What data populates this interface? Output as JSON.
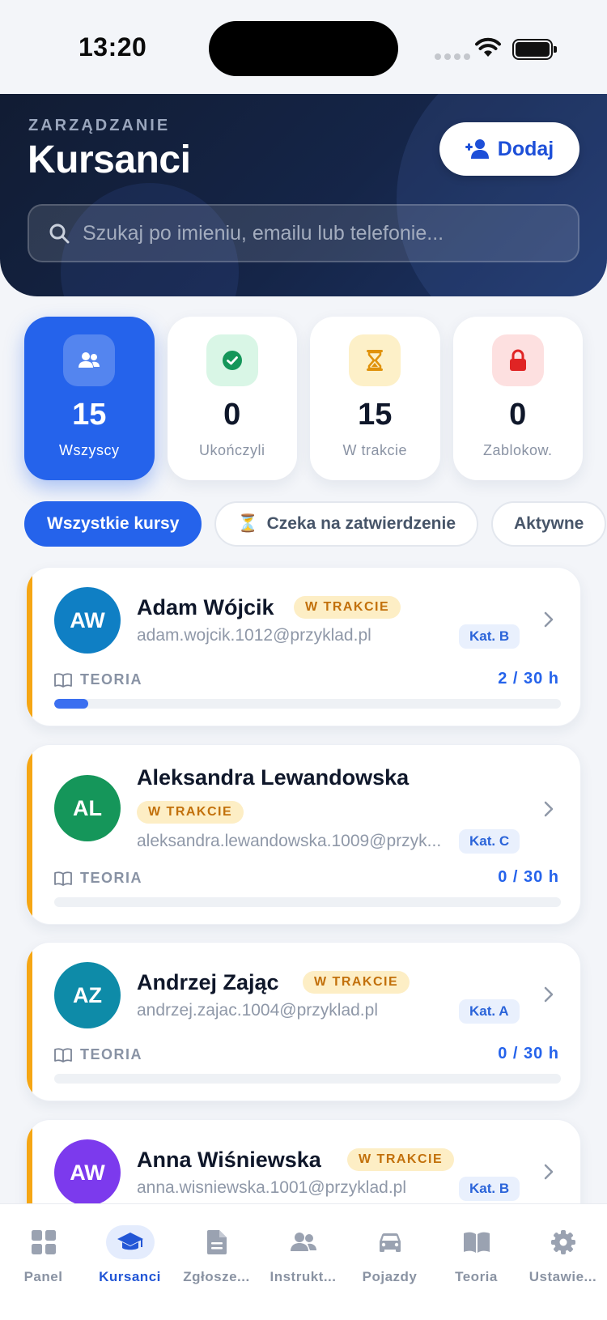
{
  "status_bar": {
    "time": "13:20"
  },
  "header": {
    "eyebrow": "ZARZĄDZANIE",
    "title": "Kursanci",
    "add_button": "Dodaj",
    "search_placeholder": "Szukaj po imieniu, emailu lub telefonie..."
  },
  "stats": [
    {
      "value": "15",
      "label": "Wszyscy",
      "icon": "users-icon",
      "active": true
    },
    {
      "value": "0",
      "label": "Ukończyli",
      "icon": "check-icon"
    },
    {
      "value": "15",
      "label": "W trakcie",
      "icon": "hourglass-icon"
    },
    {
      "value": "0",
      "label": "Zablokow.",
      "icon": "lock-icon"
    }
  ],
  "filters": [
    {
      "label": "Wszystkie kursy",
      "active": true
    },
    {
      "emoji": "⏳",
      "label": "Czeka na zatwierdzenie"
    },
    {
      "label": "Aktywne"
    }
  ],
  "students": [
    {
      "initials": "AW",
      "name": "Adam Wójcik",
      "status": "W TRAKCIE",
      "email": "adam.wojcik.1012@przyklad.pl",
      "category": "Kat. B",
      "theory_label": "TEORIA",
      "hours": "2 / 30 h",
      "progress": 0.067,
      "avatar_color": "#0f7fc4"
    },
    {
      "initials": "AL",
      "name": "Aleksandra Lewandowska",
      "status": "W TRAKCIE",
      "email": "aleksandra.lewandowska.1009@przyk...",
      "category": "Kat. C",
      "theory_label": "TEORIA",
      "hours": "0 / 30 h",
      "progress": 0,
      "avatar_color": "#15965a"
    },
    {
      "initials": "AZ",
      "name": "Andrzej Zając",
      "status": "W TRAKCIE",
      "email": "andrzej.zajac.1004@przyklad.pl",
      "category": "Kat. A",
      "theory_label": "TEORIA",
      "hours": "0 / 30 h",
      "progress": 0,
      "avatar_color": "#0e8ba8"
    },
    {
      "initials": "AW",
      "name": "Anna Wiśniewska",
      "status": "W TRAKCIE",
      "email": "anna.wisniewska.1001@przyklad.pl",
      "category": "Kat. B",
      "avatar_color": "#7c3aed"
    }
  ],
  "tabbar": [
    {
      "label": "Panel",
      "icon": "grid-icon"
    },
    {
      "label": "Kursanci",
      "icon": "graduation-cap-icon",
      "active": true
    },
    {
      "label": "Zgłosze...",
      "icon": "document-icon"
    },
    {
      "label": "Instrukt...",
      "icon": "users-icon"
    },
    {
      "label": "Pojazdy",
      "icon": "car-icon"
    },
    {
      "label": "Teoria",
      "icon": "book-icon"
    },
    {
      "label": "Ustawie...",
      "icon": "gear-icon"
    }
  ],
  "colors": {
    "accent": "#2563eb",
    "header_bg": "#152548",
    "status_badge_bg": "#fdeec5",
    "status_badge_text": "#c2700b",
    "card_accent": "#f5a614"
  }
}
